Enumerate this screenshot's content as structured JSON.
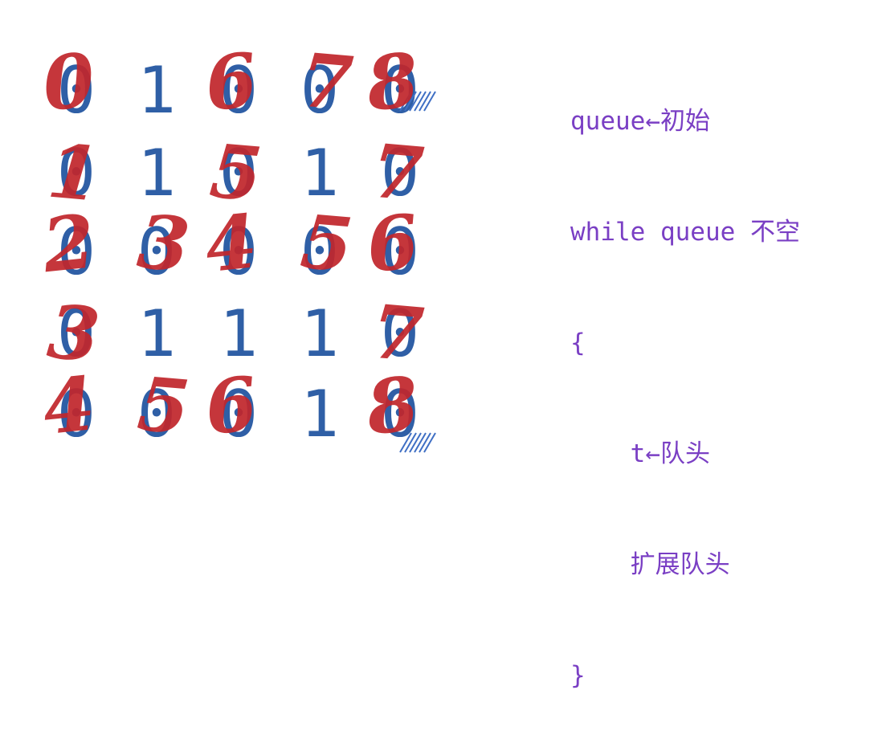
{
  "grid": {
    "rows": [
      [
        "0",
        "1",
        "0",
        "0",
        "0"
      ],
      [
        "0",
        "1",
        "0",
        "1",
        "0"
      ],
      [
        "0",
        "0",
        "0",
        "0",
        "0"
      ],
      [
        "0",
        "1",
        "1",
        "1",
        "0"
      ],
      [
        "0",
        "0",
        "0",
        "1",
        "0"
      ]
    ]
  },
  "annotations": {
    "distances": [
      [
        "0",
        "",
        "6",
        "7",
        "8"
      ],
      [
        "1",
        "",
        "5",
        "",
        "7"
      ],
      [
        "2",
        "3",
        "4",
        "5",
        "6"
      ],
      [
        "3",
        "",
        "",
        "",
        "7"
      ],
      [
        "4",
        "5",
        "6",
        "",
        "8"
      ]
    ]
  },
  "code": {
    "lines": [
      "queue←初始",
      "while queue 不空",
      "{",
      "    t←队头",
      "    扩展队头",
      "}"
    ]
  },
  "colors": {
    "grid_digit": "#2f5fa6",
    "handwriting": "#c1272d",
    "code_text": "#7a3fc4",
    "hatch": "#3f6fc4"
  }
}
